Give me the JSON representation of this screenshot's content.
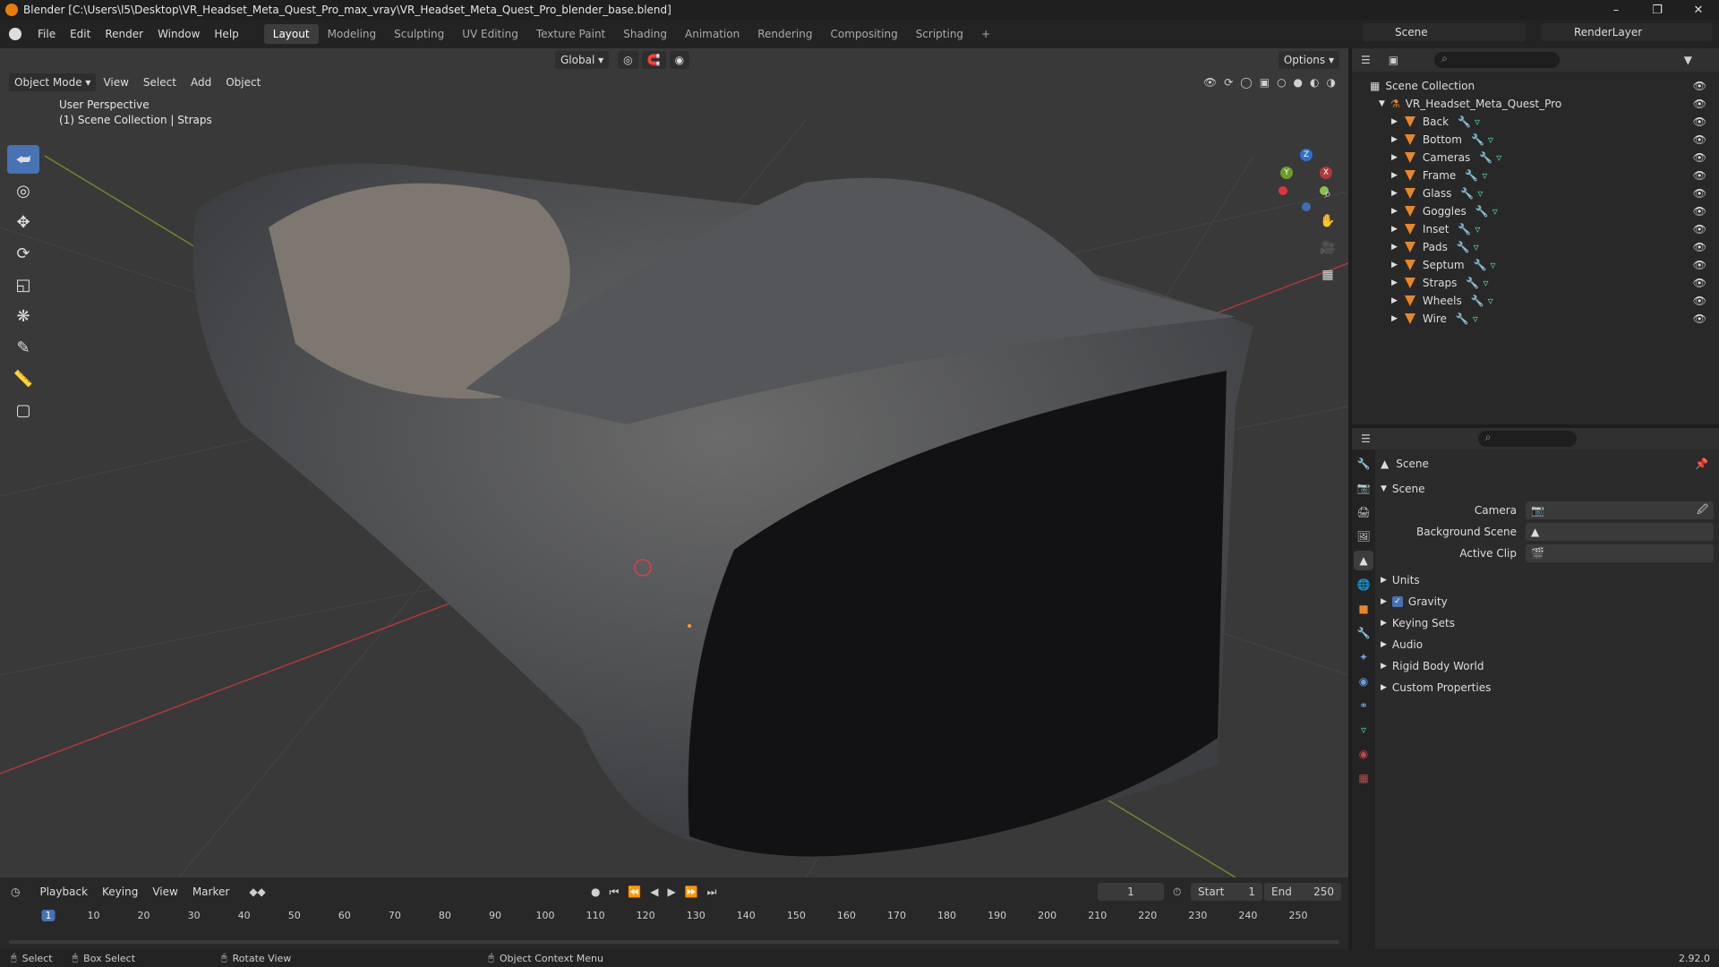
{
  "title": "Blender [C:\\Users\\l5\\Desktop\\VR_Headset_Meta_Quest_Pro_max_vray\\VR_Headset_Meta_Quest_Pro_blender_base.blend]",
  "menu": [
    "File",
    "Edit",
    "Render",
    "Window",
    "Help"
  ],
  "workspaces": [
    "Layout",
    "Modeling",
    "Sculpting",
    "UV Editing",
    "Texture Paint",
    "Shading",
    "Animation",
    "Rendering",
    "Compositing",
    "Scripting"
  ],
  "active_workspace": "Layout",
  "scene_name": "Scene",
  "view_layer": "RenderLayer",
  "viewport": {
    "orientation": "Global",
    "options": "Options",
    "mode": "Object Mode",
    "menus": [
      "View",
      "Select",
      "Add",
      "Object"
    ],
    "perspective": "User Perspective",
    "collection_info": "(1) Scene Collection | Straps",
    "axis_x": "X",
    "axis_y": "Y",
    "axis_z": "Z"
  },
  "outliner": {
    "root": "Scene Collection",
    "collection": "VR_Headset_Meta_Quest_Pro",
    "objects": [
      "Back",
      "Bottom",
      "Cameras",
      "Frame",
      "Glass",
      "Goggles",
      "Inset",
      "Pads",
      "Septum",
      "Straps",
      "Wheels",
      "Wire"
    ]
  },
  "properties": {
    "context": "Scene",
    "panel": "Scene",
    "fields": [
      {
        "label": "Camera",
        "value": ""
      },
      {
        "label": "Background Scene",
        "value": ""
      },
      {
        "label": "Active Clip",
        "value": ""
      }
    ],
    "sections": [
      "Units",
      "Gravity",
      "Keying Sets",
      "Audio",
      "Rigid Body World",
      "Custom Properties"
    ],
    "gravity_checked": true
  },
  "timeline": {
    "menus": [
      "Playback",
      "Keying",
      "View",
      "Marker"
    ],
    "current_frame": "1",
    "start_label": "Start",
    "start": "1",
    "end_label": "End",
    "end": "250",
    "ticks": [
      "1",
      "10",
      "20",
      "30",
      "40",
      "50",
      "60",
      "70",
      "80",
      "90",
      "100",
      "110",
      "120",
      "130",
      "140",
      "150",
      "160",
      "170",
      "180",
      "190",
      "200",
      "210",
      "220",
      "230",
      "240",
      "250"
    ]
  },
  "status": {
    "select": "Select",
    "box_select": "Box Select",
    "rotate": "Rotate View",
    "context_menu": "Object Context Menu",
    "version": "2.92.0"
  }
}
